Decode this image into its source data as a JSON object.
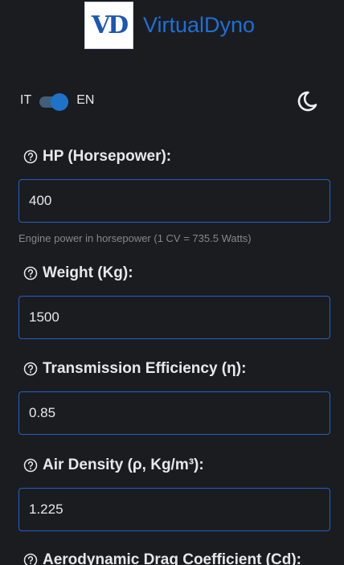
{
  "header": {
    "logo_text": "VD",
    "brand": "VirtualDyno"
  },
  "language": {
    "left": "IT",
    "right": "EN",
    "selected": "EN"
  },
  "theme": {
    "icon": "moon-icon",
    "mode": "dark"
  },
  "fields": [
    {
      "label": "HP (Horsepower):",
      "value": "400",
      "hint": "Engine power in horsepower (1 CV = 735.5 Watts)"
    },
    {
      "label": "Weight (Kg):",
      "value": "1500"
    },
    {
      "label": "Transmission Efficiency (η):",
      "value": "0.85"
    },
    {
      "label": "Air Density (ρ, Kg/m³):",
      "value": "1.225"
    },
    {
      "label": "Aerodynamic Drag Coefficient (Cd):"
    }
  ],
  "colors": {
    "background": "#1b1c20",
    "accent": "#1e73c8",
    "input_border": "#1e63c4"
  }
}
